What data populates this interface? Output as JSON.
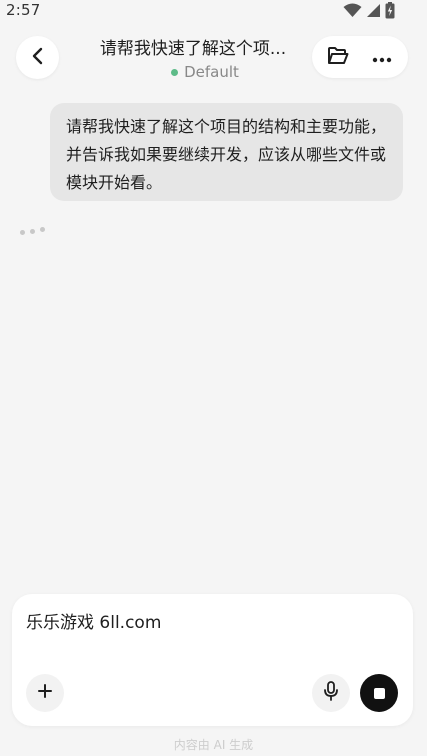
{
  "status_bar": {
    "time": "2:57",
    "icons": [
      "wifi-icon",
      "cellular-signal-icon",
      "battery-charging-icon"
    ]
  },
  "header": {
    "title": "请帮我快速了解这个项...",
    "subtitle": "Default",
    "status_color": "#5dbb88",
    "back_icon": "chevron-left-icon",
    "folder_icon": "folder-open-icon",
    "more_icon": "more-horizontal-icon"
  },
  "conversation": {
    "user_message": "请帮我快速了解这个项目的结构和主要功能，并告诉我如果要继续开发，应该从哪些文件或模块开始看。",
    "assistant_state": "typing"
  },
  "composer": {
    "input_value": "乐乐游戏 6ll.com",
    "add_icon": "plus-icon",
    "mic_icon": "microphone-icon",
    "stop_icon": "stop-icon"
  },
  "footer": {
    "note": "内容由 AI 生成"
  },
  "colors": {
    "background": "#f5f5f5",
    "bubble": "#e6e6e6",
    "stop_button": "#111111"
  }
}
